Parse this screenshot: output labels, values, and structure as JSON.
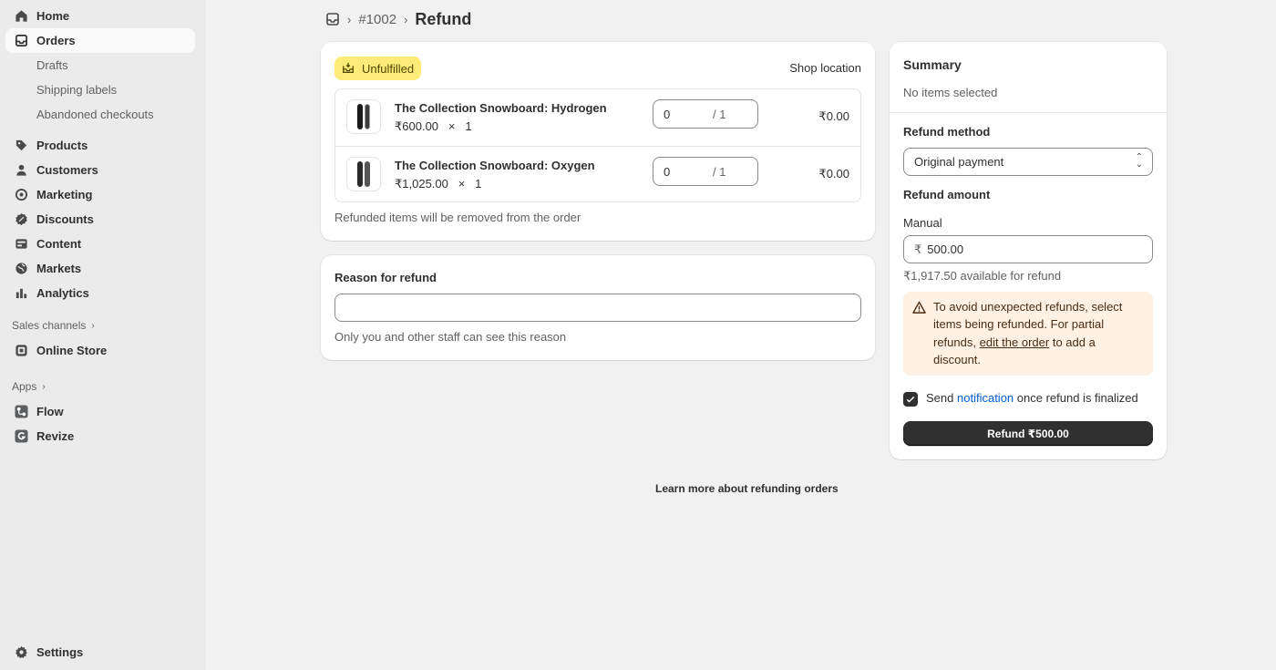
{
  "sidebar": {
    "items": [
      {
        "label": "Home",
        "icon": "home-icon"
      },
      {
        "label": "Orders",
        "icon": "inbox-icon"
      },
      {
        "label": "Products",
        "icon": "tag-icon"
      },
      {
        "label": "Customers",
        "icon": "person-icon"
      },
      {
        "label": "Marketing",
        "icon": "target-icon"
      },
      {
        "label": "Discounts",
        "icon": "discount-icon"
      },
      {
        "label": "Content",
        "icon": "content-icon"
      },
      {
        "label": "Markets",
        "icon": "globe-icon"
      },
      {
        "label": "Analytics",
        "icon": "bar-chart-icon"
      }
    ],
    "order_subitems": [
      "Drafts",
      "Shipping labels",
      "Abandoned checkouts"
    ],
    "sales_channels_label": "Sales channels",
    "online_store_label": "Online Store",
    "apps_label": "Apps",
    "apps": [
      "Flow",
      "Revize"
    ],
    "settings_label": "Settings"
  },
  "breadcrumb": {
    "order": "#1002",
    "title": "Refund"
  },
  "items_card": {
    "badge": "Unfulfilled",
    "location": "Shop location",
    "items": [
      {
        "name": "The Collection Snowboard: Hydrogen",
        "price": "₹600.00",
        "times": "×",
        "qty": "1",
        "refund_qty": "0",
        "max": "/ 1",
        "total": "₹0.00"
      },
      {
        "name": "The Collection Snowboard: Oxygen",
        "price": "₹1,025.00",
        "times": "×",
        "qty": "1",
        "refund_qty": "0",
        "max": "/ 1",
        "total": "₹0.00"
      }
    ],
    "note": "Refunded items will be removed from the order"
  },
  "reason_card": {
    "title": "Reason for refund",
    "input_value": "",
    "help": "Only you and other staff can see this reason"
  },
  "summary": {
    "title": "Summary",
    "no_items": "No items selected",
    "refund_method_label": "Refund method",
    "refund_method_value": "Original payment",
    "refund_amount_label": "Refund amount",
    "manual_label": "Manual",
    "currency_symbol": "₹",
    "amount_value": "500.00",
    "available": "₹1,917.50 available for refund",
    "warning_prefix": "To avoid unexpected refunds, select items being refunded. For partial refunds,",
    "warning_link": "edit the order",
    "warning_suffix": "to add a discount.",
    "notify_prefix": "Send",
    "notify_link": "notification",
    "notify_suffix": "once refund is finalized",
    "notify_checked": true,
    "refund_button": "Refund ₹500.00"
  },
  "footer_link": "Learn more about refunding orders",
  "colors": {
    "badge_bg": "#ffeb78",
    "warning_bg": "#fff1e3",
    "link": "#005bd3",
    "primary_button": "#303030"
  }
}
